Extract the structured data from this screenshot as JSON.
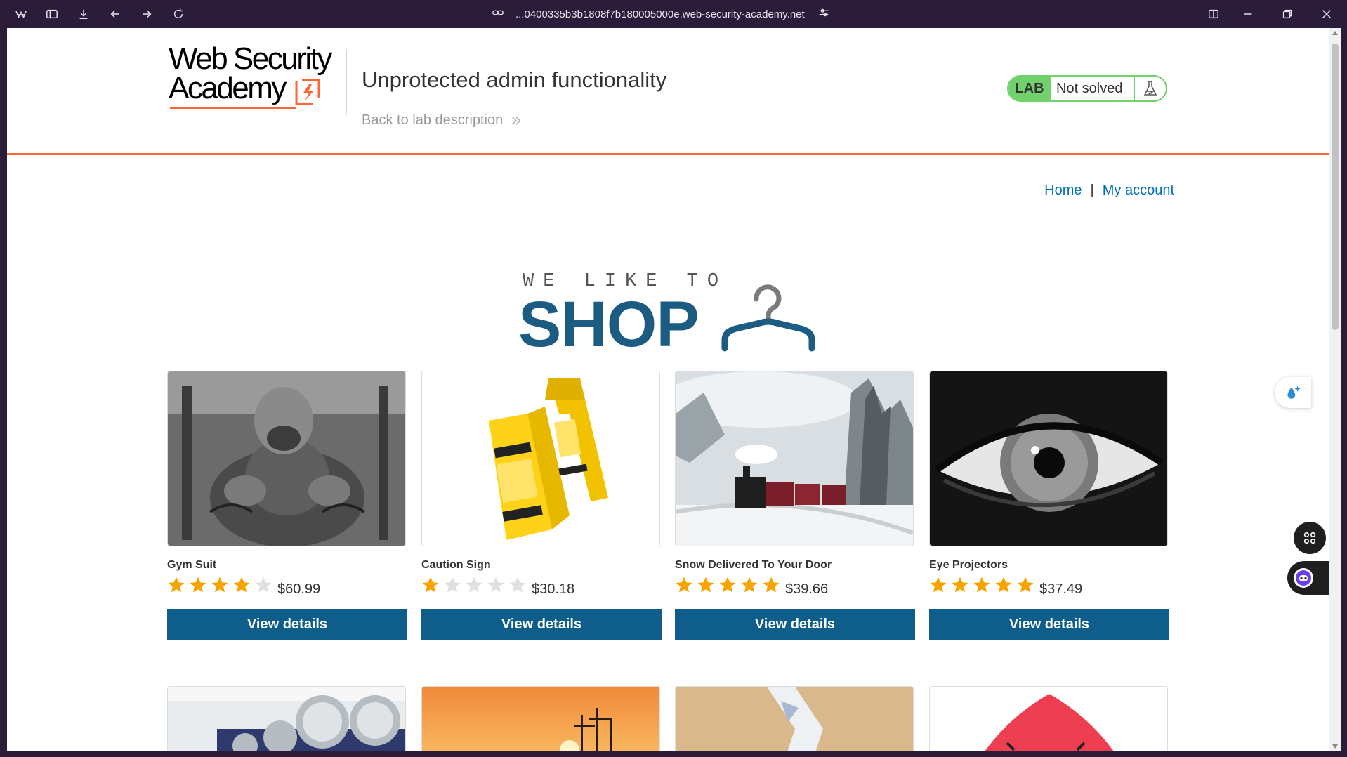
{
  "browser": {
    "url": "...0400335b3b1808f7b180005000e.web-security-academy.net"
  },
  "header": {
    "logo_line1": "Web Security",
    "logo_line2": "Academy",
    "lab_title": "Unprotected admin functionality",
    "back_link": "Back to lab description",
    "lab_tag": "LAB",
    "lab_status": "Not solved"
  },
  "nav": {
    "home": "Home",
    "separator": "|",
    "account": "My account"
  },
  "banner": {
    "top": "WE LIKE TO",
    "main": "SHOP"
  },
  "products": [
    {
      "name": "Gym Suit",
      "price": "$60.99",
      "rating": 4,
      "button": "View details"
    },
    {
      "name": "Caution Sign",
      "price": "$30.18",
      "rating": 1,
      "button": "View details"
    },
    {
      "name": "Snow Delivered To Your Door",
      "price": "$39.66",
      "rating": 5,
      "button": "View details"
    },
    {
      "name": "Eye Projectors",
      "price": "$37.49",
      "rating": 5,
      "button": "View details"
    }
  ],
  "colors": {
    "accent": "#ff6633",
    "button": "#0e5d8a",
    "link": "#0071bc",
    "lab_green": "#70d16d",
    "star": "#f7a300",
    "star_empty": "#e0e0e0"
  },
  "icons": [
    "spaces-icon",
    "sidebar-icon",
    "download-icon",
    "back-icon",
    "forward-icon",
    "reload-icon",
    "link-icon",
    "site-settings-icon",
    "split-view-icon",
    "minimize-icon",
    "restore-icon",
    "close-icon",
    "flask-icon",
    "chevron-double-right-icon",
    "hanger-icon",
    "star-icon"
  ]
}
